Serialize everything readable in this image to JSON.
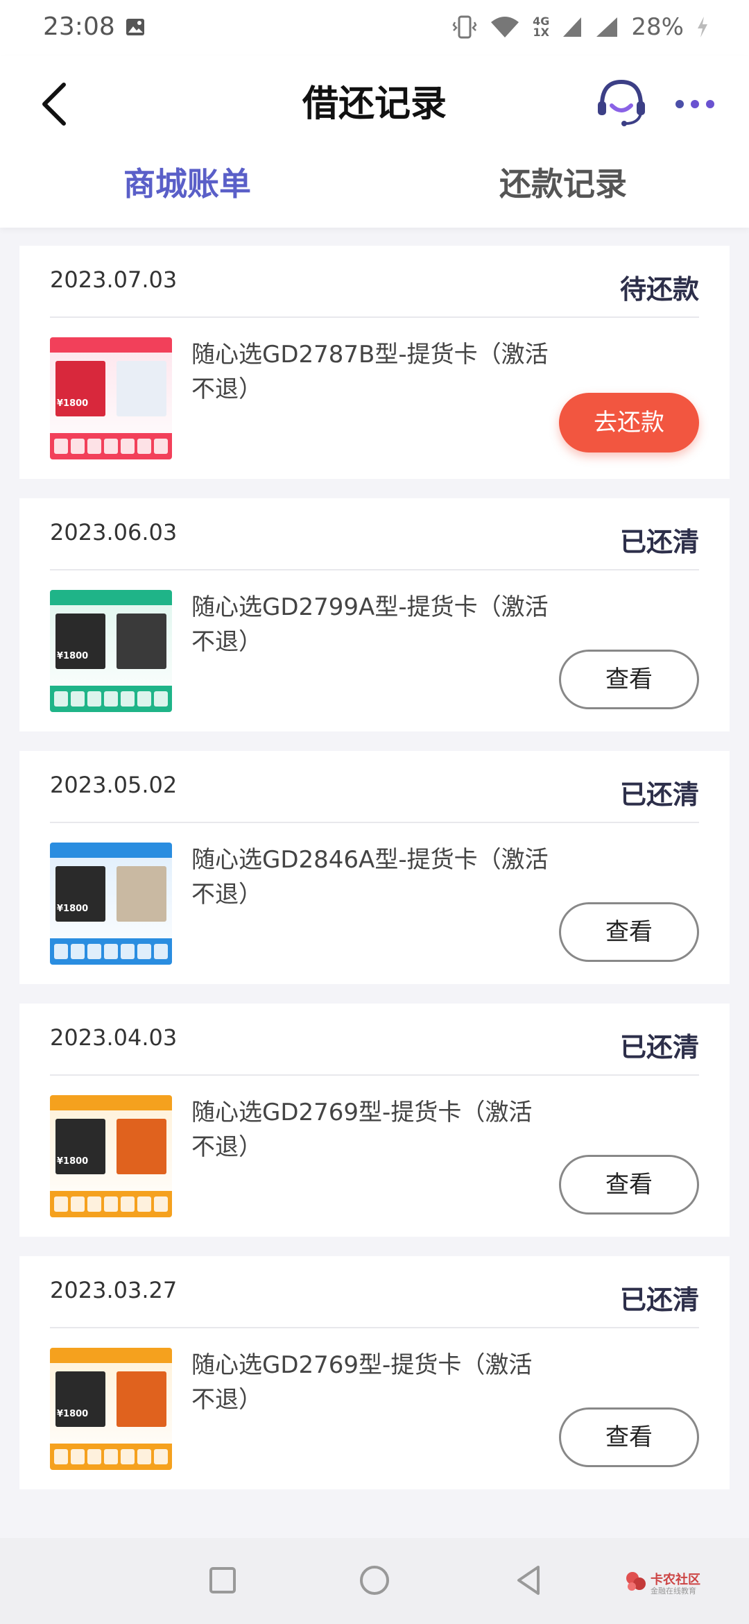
{
  "status_bar": {
    "time": "23:08",
    "network": "4G\n1X",
    "battery": "28%"
  },
  "header": {
    "title": "借还记录"
  },
  "tabs": [
    {
      "label": "商城账单",
      "active": true
    },
    {
      "label": "还款记录",
      "active": false
    }
  ],
  "records": [
    {
      "date": "2023.07.03",
      "status": "待还款",
      "product": "随心选GD2787B型-提货卡（激活不退）",
      "action": "去还款",
      "thumb_color": "#f2405a",
      "thumb_price": "¥1800"
    },
    {
      "date": "2023.06.03",
      "status": "已还清",
      "product": "随心选GD2799A型-提货卡（激活不退）",
      "action": "查看",
      "thumb_color": "#1fb488",
      "thumb_price": "¥1800"
    },
    {
      "date": "2023.05.02",
      "status": "已还清",
      "product": "随心选GD2846A型-提货卡（激活不退）",
      "action": "查看",
      "thumb_color": "#2a8de0",
      "thumb_price": "¥1800"
    },
    {
      "date": "2023.04.03",
      "status": "已还清",
      "product": "随心选GD2769型-提货卡（激活不退）",
      "action": "查看",
      "thumb_color": "#f5a11e",
      "thumb_price": "¥1800"
    },
    {
      "date": "2023.03.27",
      "status": "已还清",
      "product": "随心选GD2769型-提货卡（激活不退）",
      "action": "查看",
      "thumb_color": "#f5a11e",
      "thumb_price": "¥1800"
    }
  ],
  "watermark": {
    "title": "卡农社区",
    "subtitle": "金融在线教育"
  },
  "colors": {
    "accent": "#5a5fc8",
    "pay_button": "#f25640",
    "status_text": "#2d2f4a"
  }
}
